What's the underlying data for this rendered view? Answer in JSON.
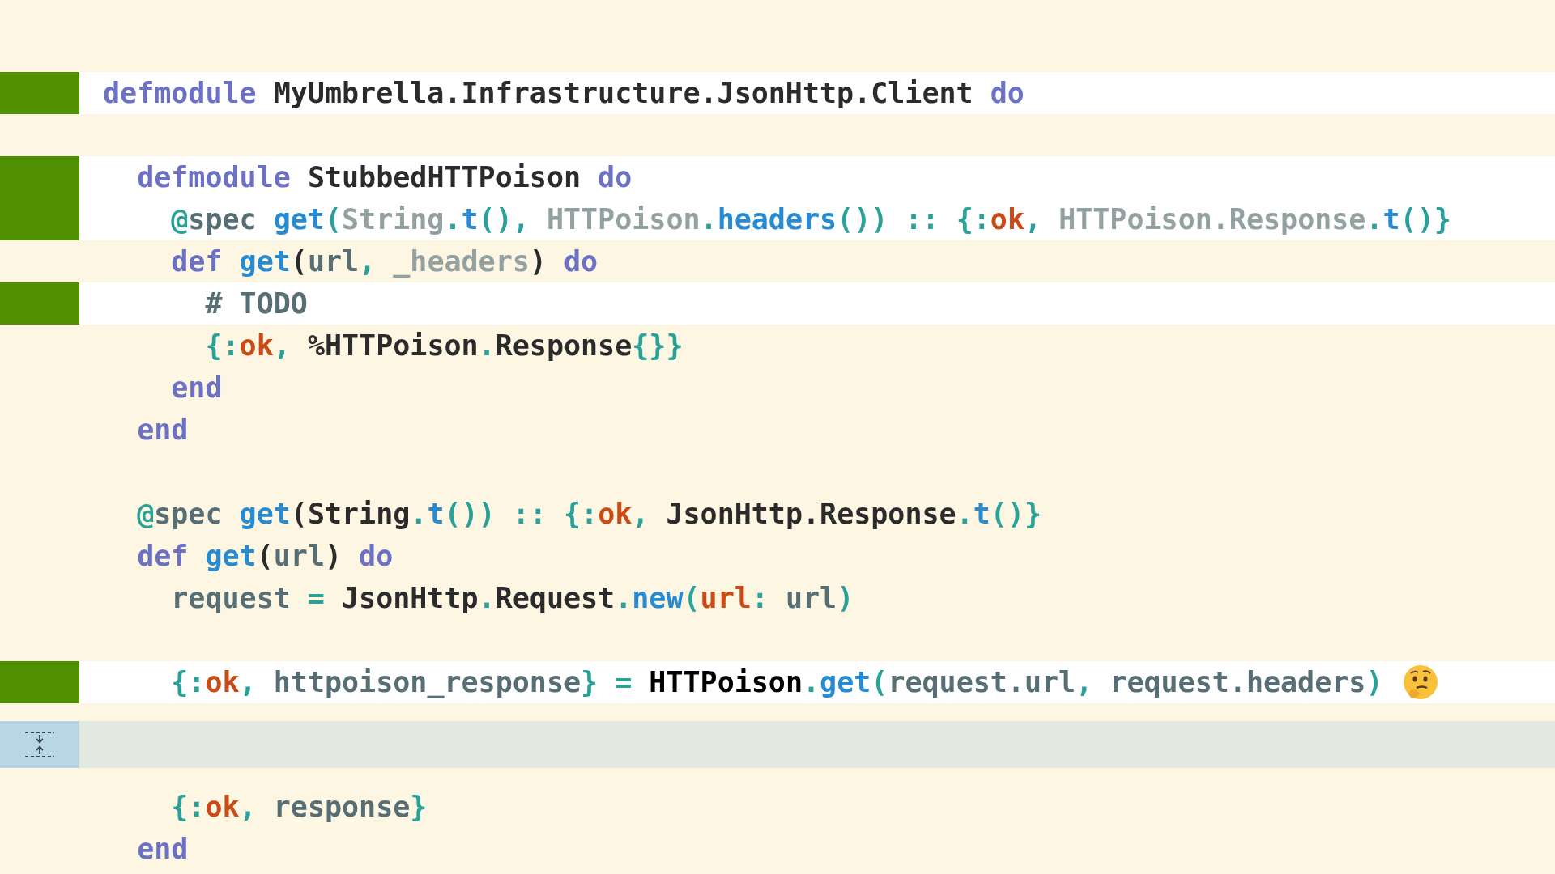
{
  "lines": [
    {
      "kind": "code",
      "highlighted": true,
      "tokens": [
        {
          "t": "defmodule ",
          "kind": "kw"
        },
        {
          "t": "MyUmbrella.Infrastructure.JsonHttp.Client ",
          "kind": "module"
        },
        {
          "t": "do",
          "kind": "kw"
        }
      ]
    },
    {
      "kind": "blank"
    },
    {
      "kind": "code",
      "highlighted": true,
      "tokens": [
        {
          "t": "  defmodule ",
          "kind": "kw"
        },
        {
          "t": "StubbedHTTPoison ",
          "kind": "module"
        },
        {
          "t": "do",
          "kind": "kw"
        }
      ]
    },
    {
      "kind": "code",
      "highlighted": true,
      "tokens": [
        {
          "t": "    @",
          "kind": "punct"
        },
        {
          "t": "spec ",
          "kind": "var"
        },
        {
          "t": "get",
          "kind": "fn"
        },
        {
          "t": "(",
          "kind": "punct"
        },
        {
          "t": "String",
          "kind": "muted"
        },
        {
          "t": ".",
          "kind": "punct"
        },
        {
          "t": "t",
          "kind": "fn"
        },
        {
          "t": "(), ",
          "kind": "punct"
        },
        {
          "t": "HTTPoison",
          "kind": "muted"
        },
        {
          "t": ".",
          "kind": "punct"
        },
        {
          "t": "headers",
          "kind": "fn"
        },
        {
          "t": "()) :: {:",
          "kind": "punct"
        },
        {
          "t": "ok",
          "kind": "atom"
        },
        {
          "t": ", ",
          "kind": "punct"
        },
        {
          "t": "HTTPoison.Response",
          "kind": "muted"
        },
        {
          "t": ".",
          "kind": "punct"
        },
        {
          "t": "t",
          "kind": "fn"
        },
        {
          "t": "()}",
          "kind": "punct"
        }
      ]
    },
    {
      "kind": "code",
      "highlighted": false,
      "tokens": [
        {
          "t": "    def ",
          "kind": "kw"
        },
        {
          "t": "get",
          "kind": "fn"
        },
        {
          "t": "(",
          "kind": "module"
        },
        {
          "t": "url",
          "kind": "var"
        },
        {
          "t": ", ",
          "kind": "punct"
        },
        {
          "t": "_headers",
          "kind": "muted"
        },
        {
          "t": ") ",
          "kind": "module"
        },
        {
          "t": "do",
          "kind": "kw"
        }
      ]
    },
    {
      "kind": "code",
      "highlighted": true,
      "tokens": [
        {
          "t": "      # TODO",
          "kind": "var"
        }
      ]
    },
    {
      "kind": "code",
      "highlighted": false,
      "tokens": [
        {
          "t": "      {:",
          "kind": "punct"
        },
        {
          "t": "ok",
          "kind": "atom"
        },
        {
          "t": ", ",
          "kind": "punct"
        },
        {
          "t": "%HTTPoison",
          "kind": "module"
        },
        {
          "t": ".",
          "kind": "punct"
        },
        {
          "t": "Response",
          "kind": "module"
        },
        {
          "t": "{}}",
          "kind": "punct"
        }
      ]
    },
    {
      "kind": "code",
      "highlighted": false,
      "tokens": [
        {
          "t": "    end",
          "kind": "kw"
        }
      ]
    },
    {
      "kind": "code",
      "highlighted": false,
      "tokens": [
        {
          "t": "  end",
          "kind": "kw"
        }
      ]
    },
    {
      "kind": "blank"
    },
    {
      "kind": "code",
      "highlighted": false,
      "tokens": [
        {
          "t": "  @",
          "kind": "punct"
        },
        {
          "t": "spec ",
          "kind": "var"
        },
        {
          "t": "get",
          "kind": "fn"
        },
        {
          "t": "(",
          "kind": "module"
        },
        {
          "t": "String",
          "kind": "module"
        },
        {
          "t": ".",
          "kind": "punct"
        },
        {
          "t": "t",
          "kind": "fn"
        },
        {
          "t": "()) :: {:",
          "kind": "punct"
        },
        {
          "t": "ok",
          "kind": "atom"
        },
        {
          "t": ", ",
          "kind": "punct"
        },
        {
          "t": "JsonHttp.Response",
          "kind": "module"
        },
        {
          "t": ".",
          "kind": "punct"
        },
        {
          "t": "t",
          "kind": "fn"
        },
        {
          "t": "()}",
          "kind": "punct"
        }
      ]
    },
    {
      "kind": "code",
      "highlighted": false,
      "tokens": [
        {
          "t": "  def ",
          "kind": "kw"
        },
        {
          "t": "get",
          "kind": "fn"
        },
        {
          "t": "(",
          "kind": "module"
        },
        {
          "t": "url",
          "kind": "var"
        },
        {
          "t": ") ",
          "kind": "module"
        },
        {
          "t": "do",
          "kind": "kw"
        }
      ]
    },
    {
      "kind": "code",
      "highlighted": false,
      "tokens": [
        {
          "t": "    request",
          "kind": "var"
        },
        {
          "t": " = ",
          "kind": "punct"
        },
        {
          "t": "JsonHttp",
          "kind": "module"
        },
        {
          "t": ".",
          "kind": "punct"
        },
        {
          "t": "Request",
          "kind": "module"
        },
        {
          "t": ".",
          "kind": "punct"
        },
        {
          "t": "new",
          "kind": "fn"
        },
        {
          "t": "(",
          "kind": "punct"
        },
        {
          "t": "url",
          "kind": "atom"
        },
        {
          "t": ": ",
          "kind": "punct"
        },
        {
          "t": "url",
          "kind": "var"
        },
        {
          "t": ")",
          "kind": "punct"
        }
      ]
    },
    {
      "kind": "blank"
    },
    {
      "kind": "code_with_emoji",
      "highlighted": true,
      "tokens": [
        {
          "t": "    {:",
          "kind": "punct"
        },
        {
          "t": "ok",
          "kind": "atom"
        },
        {
          "t": ", ",
          "kind": "punct"
        },
        {
          "t": "httpoison_response",
          "kind": "var"
        },
        {
          "t": "} = ",
          "kind": "punct"
        },
        {
          "t": "HTTPoison",
          "kind": "strong"
        },
        {
          "t": ".",
          "kind": "punct"
        },
        {
          "t": "get",
          "kind": "fn"
        },
        {
          "t": "(",
          "kind": "punct"
        },
        {
          "t": "request.url",
          "kind": "var"
        },
        {
          "t": ", ",
          "kind": "punct"
        },
        {
          "t": "request.headers",
          "kind": "var"
        },
        {
          "t": ")",
          "kind": "punct"
        }
      ]
    },
    {
      "kind": "collapsed"
    },
    {
      "kind": "code",
      "highlighted": false,
      "tokens": [
        {
          "t": "    {:",
          "kind": "punct"
        },
        {
          "t": "ok",
          "kind": "atom"
        },
        {
          "t": ", ",
          "kind": "punct"
        },
        {
          "t": "response",
          "kind": "var"
        },
        {
          "t": "}",
          "kind": "punct"
        }
      ]
    },
    {
      "kind": "code",
      "highlighted": false,
      "tokens": [
        {
          "t": "  end",
          "kind": "kw"
        }
      ]
    }
  ]
}
